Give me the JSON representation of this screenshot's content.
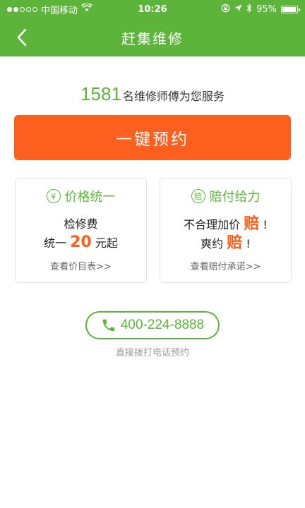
{
  "status_bar": {
    "carrier": "中国移动",
    "time": "10:26",
    "battery": "95%",
    "battery_level": 0.95
  },
  "nav": {
    "title": "赶集维修"
  },
  "tagline": {
    "count": "1581",
    "text": "名维修师傅为您服务"
  },
  "book_button": {
    "label": "一键预约"
  },
  "cards": {
    "price": {
      "icon_text": "￥",
      "title": "价格统一",
      "line1": "检修费",
      "line2_prefix": "统一",
      "line2_number": "20",
      "line2_suffix": "元起",
      "link": "查看价目表>>"
    },
    "compensation": {
      "icon_text": "赔",
      "title": "赔付给力",
      "line1_prefix": "不合理加价",
      "line1_em": "赔",
      "line1_suffix": "!",
      "line2_prefix": "爽约",
      "line2_em": "赔",
      "line2_suffix": "!",
      "link": "查看赔付承诺>>"
    }
  },
  "phone": {
    "number": "400-224-8888",
    "hint": "直接拨打电话预约"
  },
  "colors": {
    "brand_green": "#5cb53a",
    "accent_orange": "#fd5f1e"
  },
  "icons": {
    "back": "chevron-left-icon",
    "phone": "phone-icon",
    "wifi": "wifi-icon",
    "location": "location-arrow-icon",
    "bluetooth": "bluetooth-icon",
    "lock": "rotation-lock-icon"
  }
}
